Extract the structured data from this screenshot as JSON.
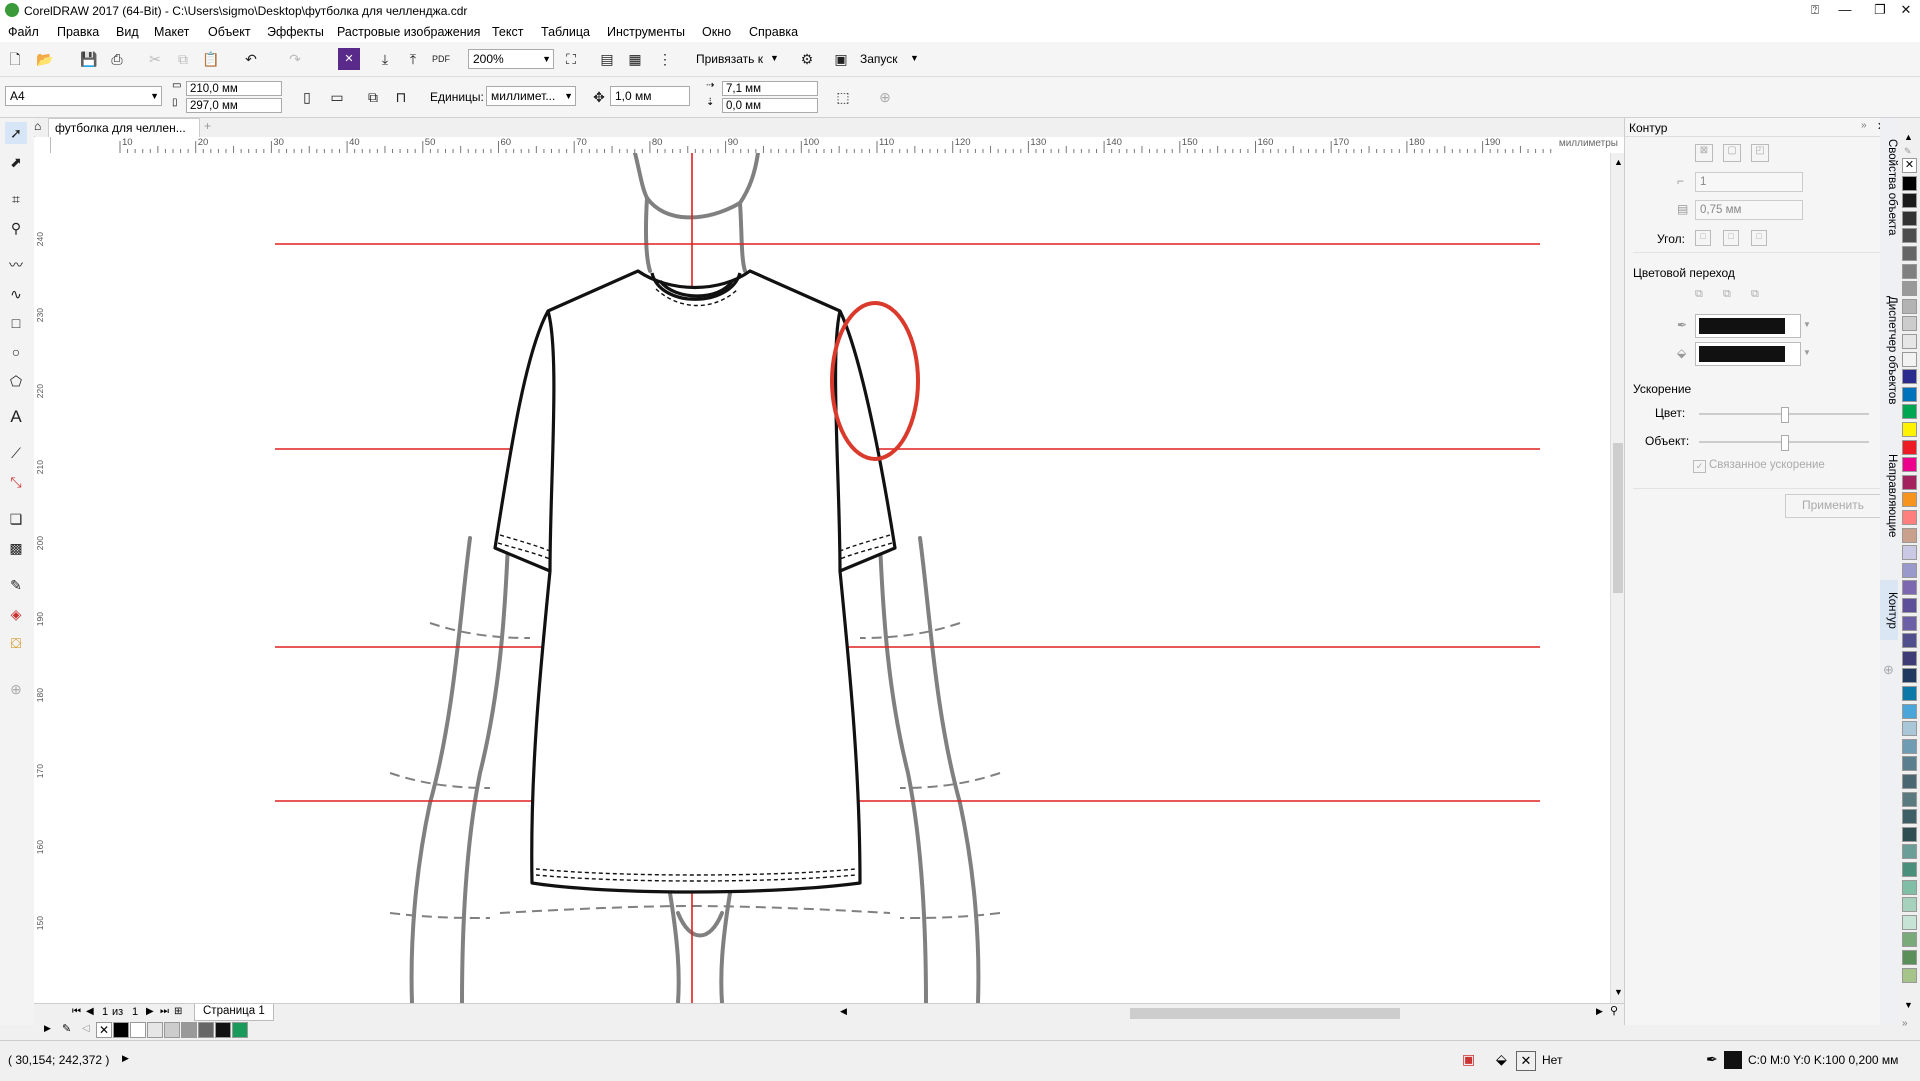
{
  "window": {
    "title": "CorelDRAW 2017 (64-Bit) - C:\\Users\\sigmo\\Desktop\\футболка для челленджа.cdr"
  },
  "menu": [
    "Файл",
    "Правка",
    "Вид",
    "Макет",
    "Объект",
    "Эффекты",
    "Растровые изображения",
    "Текст",
    "Таблица",
    "Инструменты",
    "Окно",
    "Справка"
  ],
  "toolbar": {
    "zoom": "200%",
    "snap_label": "Привязать к",
    "launch_label": "Запуск"
  },
  "propbar": {
    "page_size": "A4",
    "width": "210,0 мм",
    "height": "297,0 мм",
    "units_label": "Единицы:",
    "units_value": "миллимет...",
    "nudge": "1,0 мм",
    "dup_x": "7,1 мм",
    "dup_y": "0,0 мм"
  },
  "document_tab": {
    "name": "футболка для челлен..."
  },
  "ruler": {
    "h_ticks": [
      "10",
      "20",
      "30",
      "40",
      "50",
      "60",
      "70",
      "80",
      "90",
      "100",
      "110",
      "120",
      "130",
      "140",
      "150",
      "160",
      "170",
      "180",
      "190"
    ],
    "units": "миллиметры",
    "v_ticks": [
      "240",
      "230",
      "220",
      "210",
      "200",
      "190",
      "180",
      "170",
      "160",
      "150"
    ]
  },
  "page_nav": {
    "current": "1",
    "of": "из",
    "total": "1",
    "page_tab": "Страница 1"
  },
  "docker": {
    "title": "Контур",
    "width_value": "1",
    "thickness_value": "0,75 мм",
    "angle_label": "Угол:",
    "blend_title": "Цветовой переход",
    "accel_title": "Ускорение",
    "color_label": "Цвет:",
    "object_label": "Объект:",
    "linked_label": "Связанное ускорение",
    "apply_label": "Применить"
  },
  "side_tabs": [
    "Свойства объекта",
    "Диспетчер объектов",
    "Направляющие",
    "Контур"
  ],
  "status": {
    "coords": "( 30,154; 242,372 )",
    "fill_label": "Нет",
    "outline_info": "C:0 M:0 Y:0 K:100  0,200 мм"
  },
  "colors": {
    "guide": "#e0201e",
    "highlight": "#d93a2b",
    "tshirt": "#111111",
    "body": "#808080"
  }
}
